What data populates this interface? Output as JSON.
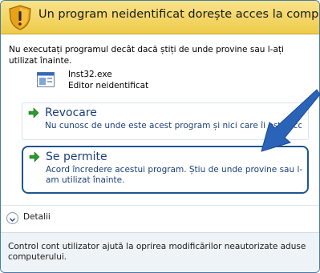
{
  "header": {
    "title": "Un program neidentificat dorește acces la computer",
    "icon": "shield-warning-icon",
    "color": "#eecb4a"
  },
  "warning": {
    "text": "Nu executați programul decât dacă știți de unde provine sau l-ați utilizat înainte."
  },
  "program": {
    "file_name": "Inst32.exe",
    "publisher": "Editor neidentificat",
    "icon": "application-icon"
  },
  "options": {
    "cancel": {
      "title": "Revocare",
      "description": "Nu cunosc de unde este acest program și nici care îi este scopul.",
      "icon": "green-arrow-icon"
    },
    "allow": {
      "title": "Se permite",
      "description": "Acord încredere acestui program. Știu de unde provine sau l-am utilizat înainte.",
      "icon": "green-arrow-icon"
    }
  },
  "details": {
    "label": "Detalii",
    "icon": "chevron-down-icon"
  },
  "footer": {
    "text": "Control cont utilizator ajută la oprirea modificărilor neautorizate aduse computerului."
  },
  "colors": {
    "accent": "#1d5592",
    "arrow": "#2a63b8"
  }
}
